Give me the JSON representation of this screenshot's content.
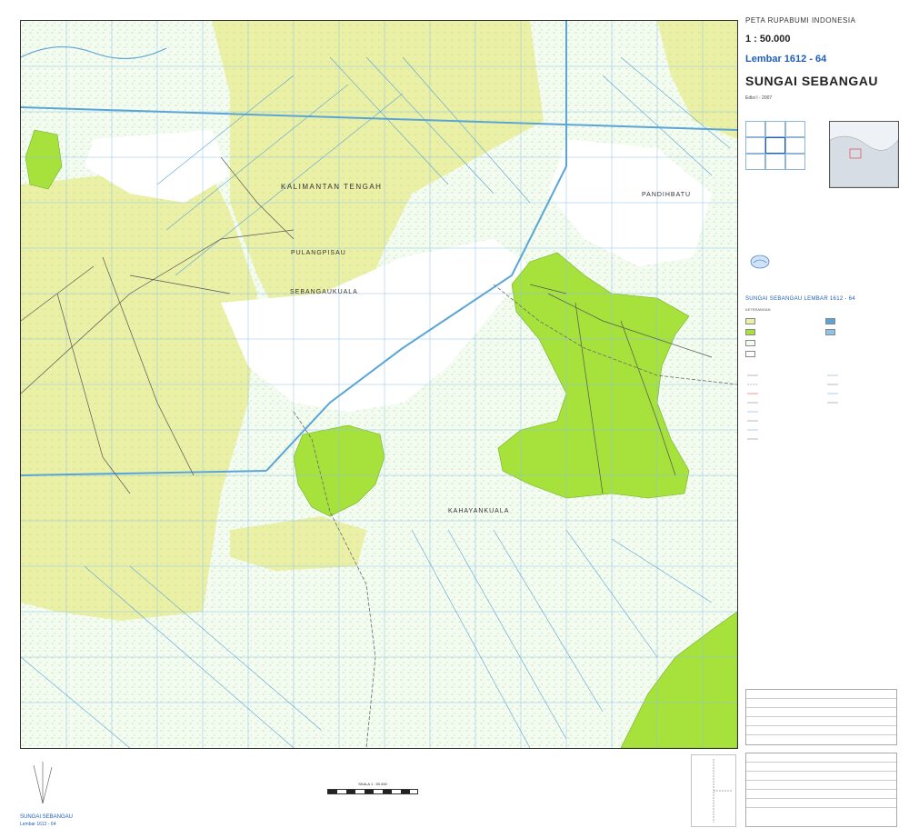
{
  "header": {
    "series_title": "PETA RUPABUMI INDONESIA",
    "scale": "1 : 50.000",
    "sheet_number": "Lembar 1612 - 64",
    "sheet_name": "SUNGAI SEBANGAU",
    "edition": "Edisi I - 2007"
  },
  "map_labels": {
    "province": "KALIMANTAN TENGAH",
    "district_1": "PULANGPISAU",
    "district_2": "SEBANGAUKUALA",
    "district_3": "KAHAYANKUALA",
    "district_4": "PANDIHBATU"
  },
  "legend_header": "SUNGAI SEBANGAU  LEMBAR  1612 - 64",
  "legend_title": "KETERANGAN",
  "scale_text": "SKALA 1 : 50.000",
  "bottom": {
    "sheet_name": "SUNGAI SEBANGAU",
    "sheet_number": "Lembar 1612 - 64"
  },
  "colors": {
    "frame": "#333333",
    "bright_green": "#a6e23b",
    "yellow_green": "#eaf0a6",
    "grid_blue": "#8fc3e8",
    "river_blue": "#5aa5d8",
    "title_blue": "#1f5fb8",
    "red": "#d33333"
  },
  "icons": {
    "agency_logo": "bakosurtanal-logo"
  }
}
